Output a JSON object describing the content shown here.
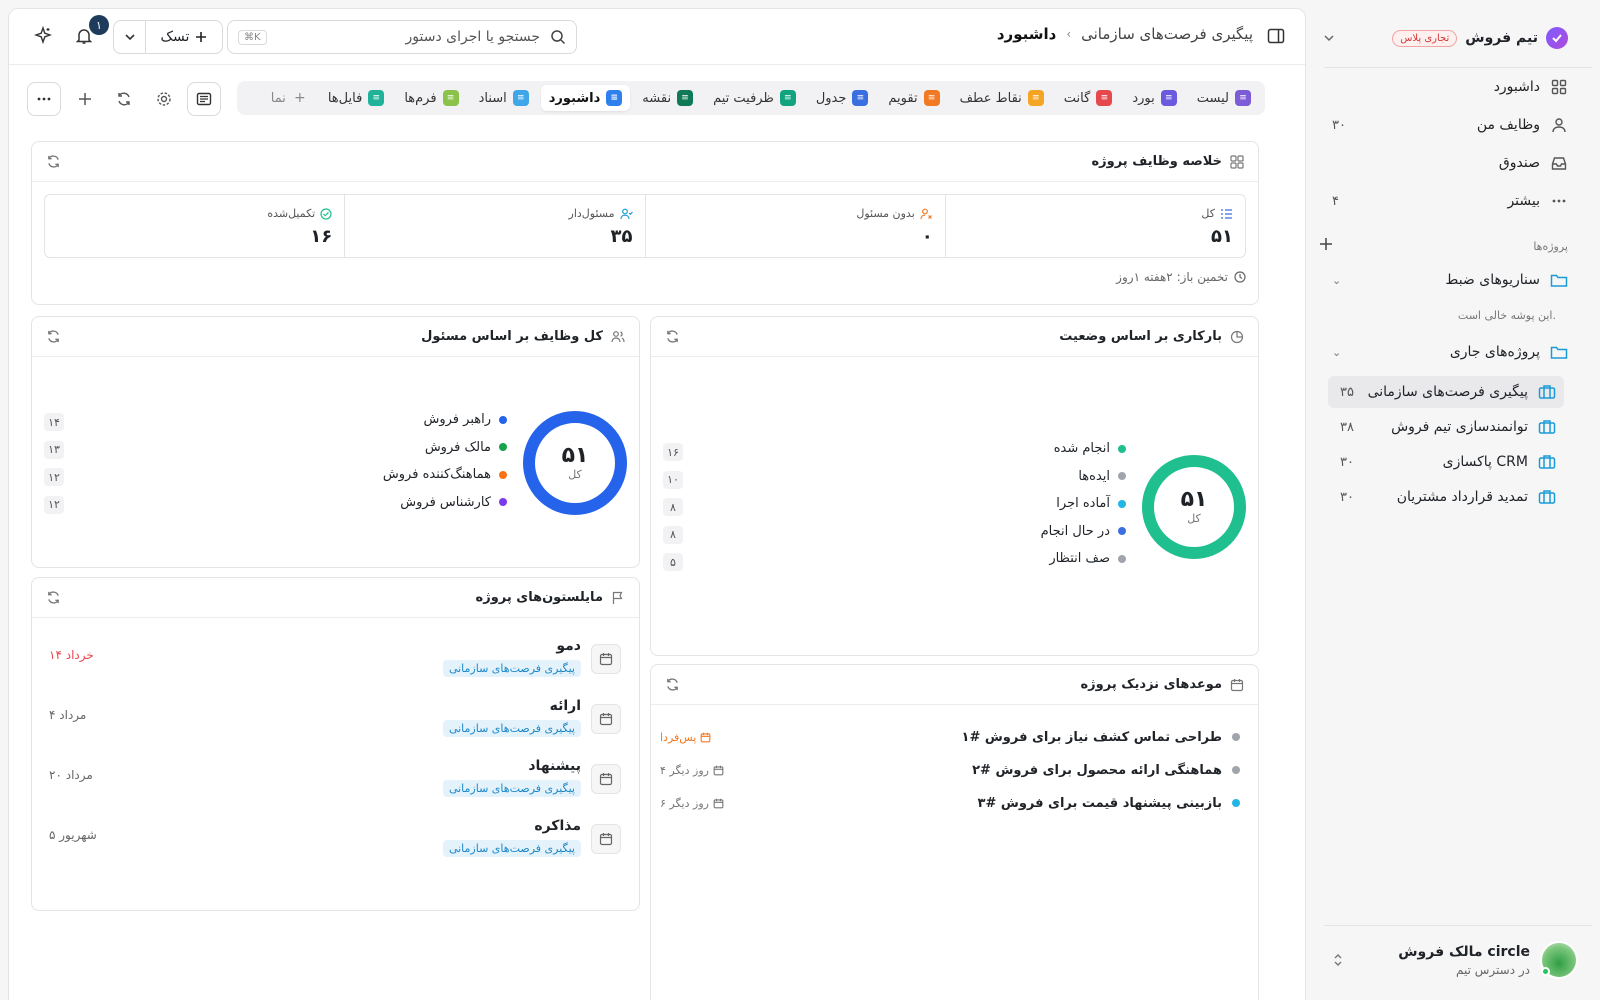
{
  "sidebar": {
    "workspace": {
      "name": "تیم فروش",
      "badge": "تجاری پلاس"
    },
    "nav": [
      {
        "label": "داشبورد",
        "icon": "grid-icon",
        "count": ""
      },
      {
        "label": "وظایف من",
        "icon": "user-icon",
        "count": "۳۰"
      },
      {
        "label": "صندوق",
        "icon": "inbox-icon",
        "count": ""
      },
      {
        "label": "بیشتر",
        "icon": "more-icon",
        "count": "۴"
      }
    ],
    "projects_title": "پروژه‌ها",
    "folders": [
      {
        "label": "سناریوهای ضبط"
      },
      {
        "label": "پروژه‌های جاری"
      }
    ],
    "empty_note": "این پوشه خالی است.",
    "projects": [
      {
        "label": "پیگیری فرصت‌های سازمانی",
        "count": "۳۵"
      },
      {
        "label": "توانمندسازی تیم فروش",
        "count": "۳۸"
      },
      {
        "label": "پاکسازی CRM",
        "count": "۳۰"
      },
      {
        "label": "تمدید قرارداد مشتریان",
        "count": "۳۰"
      }
    ],
    "user": {
      "name": "مالک فروش circle",
      "sub": "در دسترس تیم"
    }
  },
  "topbar": {
    "breadcrumb": [
      "پیگیری فرصت‌های سازمانی",
      "داشبورد"
    ],
    "search_placeholder": "جستجو یا اجرای دستور",
    "search_shortcut": "⌘K",
    "task_label": "تسک",
    "notif_count": "۱"
  },
  "tabs": [
    {
      "label": "لیست",
      "color": "#7c5cd6",
      "active": false
    },
    {
      "label": "بورد",
      "color": "#6a5ae0",
      "active": false
    },
    {
      "label": "گانت",
      "color": "#e5484d",
      "active": false
    },
    {
      "label": "نقاط عطف",
      "color": "#f5a524",
      "active": false
    },
    {
      "label": "تقویم",
      "color": "#f27a24",
      "active": false
    },
    {
      "label": "جدول",
      "color": "#3b6fe0",
      "active": false
    },
    {
      "label": "ظرفیت تیم",
      "color": "#12a37f",
      "active": false
    },
    {
      "label": "نقشه",
      "color": "#0f7a55",
      "active": false
    },
    {
      "label": "داشبورد",
      "color": "#2f80ed",
      "active": true
    },
    {
      "label": "اسناد",
      "color": "#3fa7e8",
      "active": false
    },
    {
      "label": "فرم‌ها",
      "color": "#8bc34a",
      "active": false
    },
    {
      "label": "فایل‌ها",
      "color": "#20b39a",
      "active": false
    },
    {
      "label": "نما",
      "color": "",
      "active": false
    }
  ],
  "summary": {
    "title": "خلاصه وظایف پروژه",
    "stats": [
      {
        "label": "کل",
        "value": "۵۱"
      },
      {
        "label": "بدون مسئول",
        "value": "۰"
      },
      {
        "label": "مسئول‌دار",
        "value": "۳۵"
      },
      {
        "label": "تکمیل‌شده",
        "value": "۱۶"
      }
    ],
    "estimate": "تخمین باز: ۲هفته ۱روز"
  },
  "status_card": {
    "title": "بارکاری بر اساس وضعیت",
    "total": "۵۱",
    "total_label": "کل",
    "ring_color": "#1fbf8f",
    "items": [
      {
        "label": "انجام شده",
        "value": "۱۶",
        "color": "#1fbf8f"
      },
      {
        "label": "ایده‌ها",
        "value": "۱۰",
        "color": "#a0a4ab"
      },
      {
        "label": "آماده اجرا",
        "value": "۸",
        "color": "#22b5e6"
      },
      {
        "label": "در حال انجام",
        "value": "۸",
        "color": "#3b6fe0"
      },
      {
        "label": "صف انتظار",
        "value": "۵",
        "color": "#a0a4ab"
      }
    ]
  },
  "assignee_card": {
    "title": "کل وظایف بر اساس مسئول",
    "total": "۵۱",
    "total_label": "کل",
    "ring_color": "#2563eb",
    "items": [
      {
        "label": "راهبر فروش",
        "value": "۱۴",
        "color": "#2563eb"
      },
      {
        "label": "مالک فروش",
        "value": "۱۳",
        "color": "#16a34a"
      },
      {
        "label": "هماهنگ‌کننده فروش",
        "value": "۱۲",
        "color": "#f97316"
      },
      {
        "label": "کارشناس فروش",
        "value": "۱۲",
        "color": "#7c3aed"
      }
    ]
  },
  "milestones": {
    "title": "مایلستون‌های پروژه",
    "items": [
      {
        "name": "دمو",
        "tag": "پیگیری فرصت‌های سازمانی",
        "date": "۱۴ خرداد",
        "overdue": true
      },
      {
        "name": "ارائه",
        "tag": "پیگیری فرصت‌های سازمانی",
        "date": "۴ مرداد",
        "overdue": false
      },
      {
        "name": "پیشنهاد",
        "tag": "پیگیری فرصت‌های سازمانی",
        "date": "۲۰ مرداد",
        "overdue": false
      },
      {
        "name": "مذاکره",
        "tag": "پیگیری فرصت‌های سازمانی",
        "date": "۵ شهریور",
        "overdue": false
      }
    ]
  },
  "deadlines": {
    "title": "موعدهای نزدیک پروژه",
    "items": [
      {
        "name": "طراحی تماس کشف نیاز برای فروش #۱",
        "when": "پس‌فردا",
        "color": "#a0a4ab",
        "urgent": true
      },
      {
        "name": "هماهنگی ارائه محصول برای فروش #۲",
        "when": "۴ روز دیگر",
        "color": "#a0a4ab",
        "urgent": false
      },
      {
        "name": "بازبینی پیشنهاد قیمت برای فروش #۳",
        "when": "۶ روز دیگر",
        "color": "#22b5e6",
        "urgent": false
      }
    ]
  }
}
